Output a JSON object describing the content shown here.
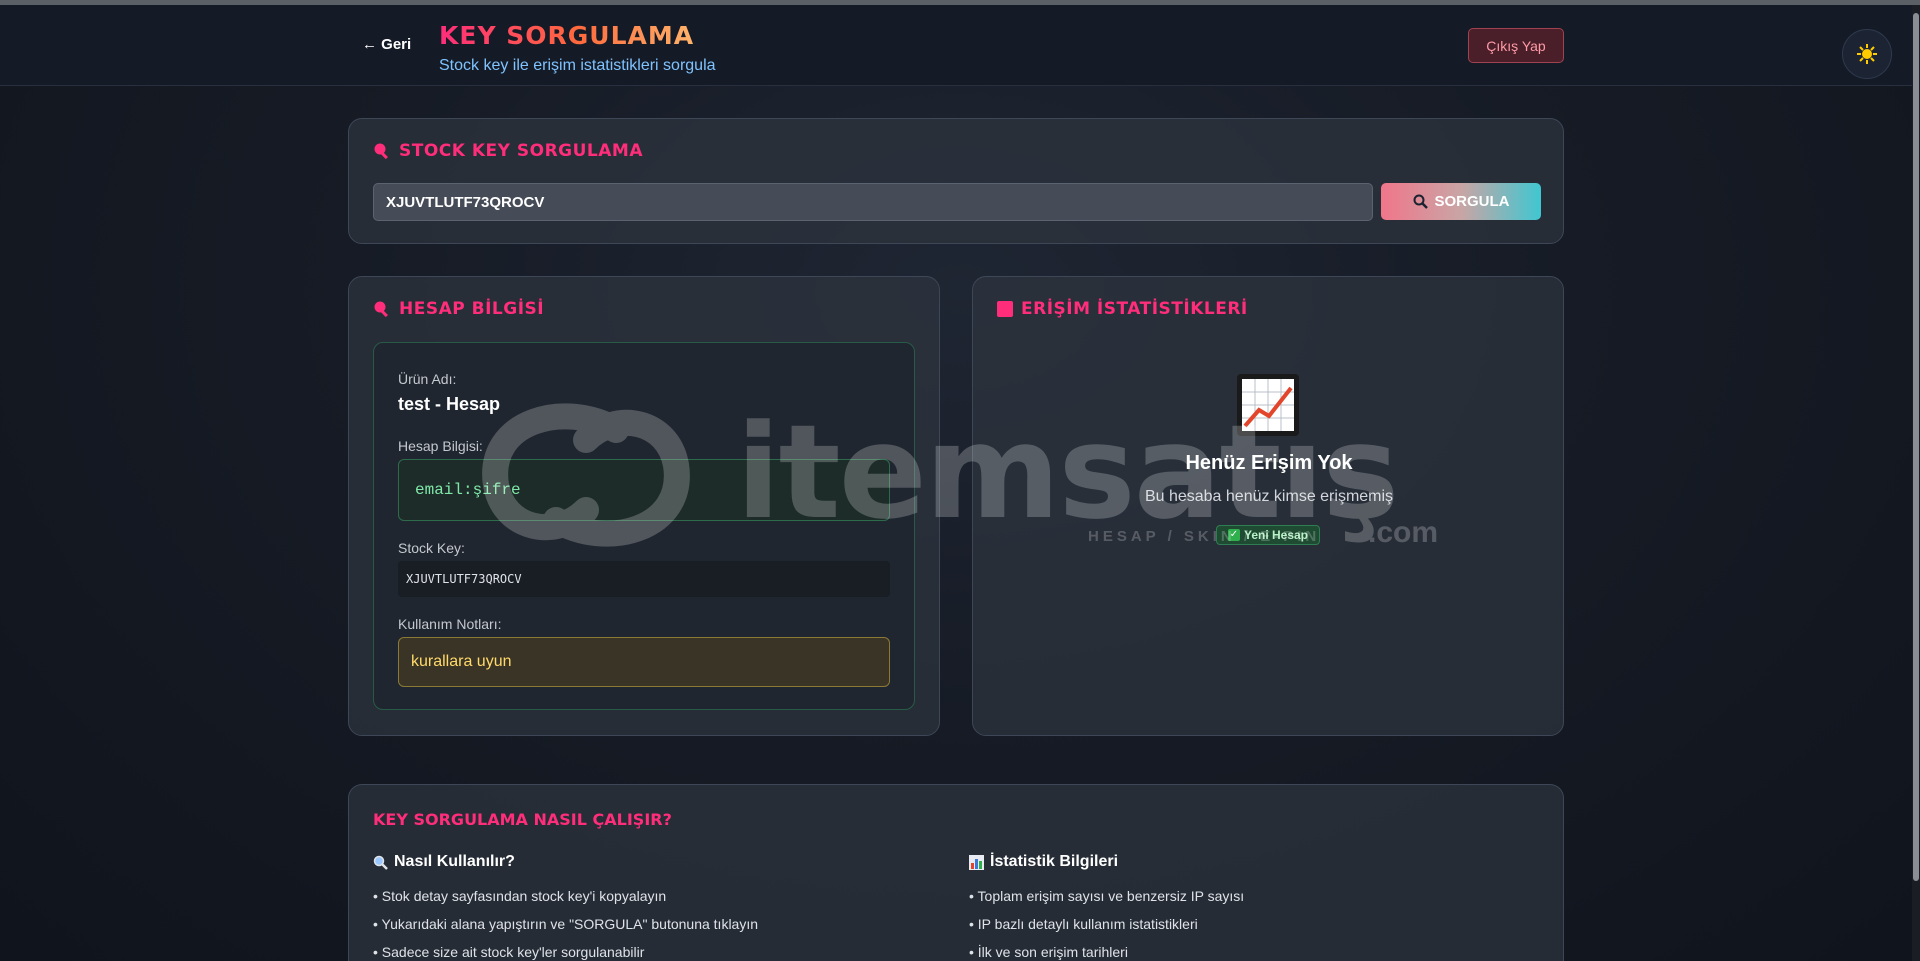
{
  "header": {
    "back_label": "← Geri",
    "title": "KEY SORGULAMA",
    "subtitle": "Stock key ile erişim istatistikleri sorgula",
    "logout_label": "Çıkış Yap",
    "theme_icon": "sun-icon"
  },
  "search_card": {
    "title": "STOCK KEY SORGULAMA",
    "input_value": "XJUVTLUTF73QROCV",
    "button_label": "SORGULA",
    "button_icon": "magnifier-icon"
  },
  "account_card": {
    "title": "HESAP BİLGİSİ",
    "product_label": "Ürün Adı:",
    "product_name": "test - Hesap",
    "account_label": "Hesap Bilgisi:",
    "account_value": "email:şifre",
    "stock_key_label": "Stock Key:",
    "stock_key_value": "XJUVTLUTF73QROCV",
    "notes_label": "Kullanım Notları:",
    "notes_value": "kurallara uyun"
  },
  "stats_card": {
    "title": "ERİŞİM İSTATİSTİKLERİ",
    "empty_title": "Henüz Erişim Yok",
    "empty_desc": "Bu hesaba henüz kimse erişmemiş",
    "badge_label": "Yeni Hesap"
  },
  "help_card": {
    "title": "KEY SORGULAMA NASIL ÇALIŞIR?",
    "usage_title": "Nasıl Kullanılır?",
    "usage_items": [
      "• Stok detay sayfasından stock key'i kopyalayın",
      "• Yukarıdaki alana yapıştırın ve \"SORGULA\" butonuna tıklayın",
      "• Sadece size ait stock key'ler sorgulanabilir"
    ],
    "stats_title": "İstatistik Bilgileri",
    "stats_items": [
      "• Toplam erişim sayısı ve benzersiz IP sayısı",
      "• IP bazlı detaylı kullanım istatistikleri",
      "• İlk ve son erişim tarihleri"
    ]
  },
  "watermark": {
    "brand": "itemsatış",
    "tagline": "HESAP / SKIN / E-PIN",
    "suffix": ".com"
  },
  "colors": {
    "accent": "#ff2d7a",
    "subtitle": "#7fc3ff",
    "success": "#2fb04c",
    "notes": "#ffd96a"
  }
}
